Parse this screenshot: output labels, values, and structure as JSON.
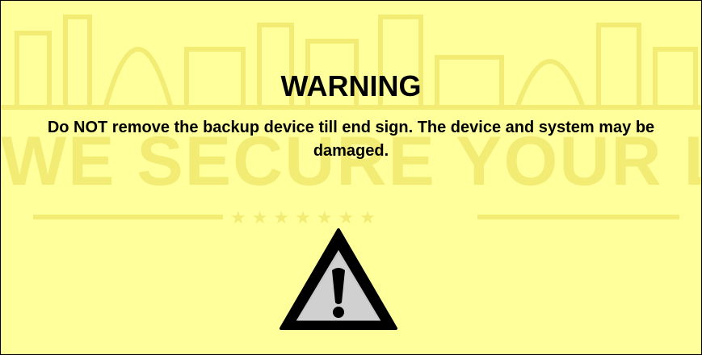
{
  "dialog": {
    "title": "WARNING",
    "message": "Do NOT remove the backup device till end sign. The device and system may be damaged.",
    "background_color": "#ffff9c",
    "icon": "warning-triangle-icon"
  },
  "watermark": {
    "text": "WE SECURE YOUR LIFE",
    "color": "#f2ec74"
  }
}
